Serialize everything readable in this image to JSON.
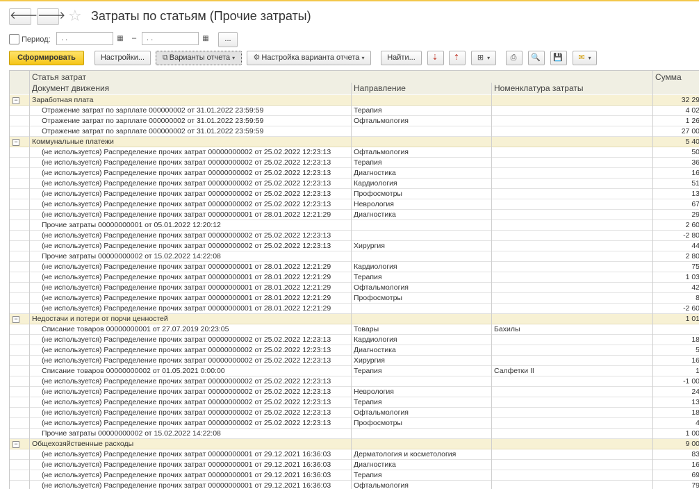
{
  "window": {
    "title": "Затраты по статьям (Прочие затраты)"
  },
  "nav": {
    "back": "🡐",
    "forward": "🡒",
    "star": "☆"
  },
  "period": {
    "label": "Период:",
    "from_value": " .  .",
    "to_value": " .  .",
    "dash": "–",
    "more_label": "..."
  },
  "toolbar": {
    "generate": "Сформировать",
    "settings": "Настройки...",
    "variants": "Варианты отчета",
    "variant_settings": "Настройка варианта отчета",
    "find": "Найти..."
  },
  "icons": {
    "calendar": "▦",
    "variants": "⧉",
    "gear": "⚙",
    "sort_desc": "⇣",
    "sort_asc": "⇡",
    "grouping": "⊞",
    "print": "⎙",
    "preview": "🔍",
    "save": "💾",
    "mail": "✉",
    "caret": "▾",
    "collapse": "−"
  },
  "report": {
    "headers": {
      "col1_line1": "Статья затрат",
      "col1_line2": "Документ движения",
      "col2": "Направление",
      "col3": "Номенклатура затраты",
      "col4": "Сумма"
    },
    "rows": [
      {
        "type": "group",
        "doc": "Заработная плата",
        "dir": "",
        "item": "",
        "sum": "32 29"
      },
      {
        "type": "row",
        "doc": "Отражение затрат по зарплате 000000002 от 31.01.2022 23:59:59",
        "dir": "Терапия",
        "item": "",
        "sum": "4 02"
      },
      {
        "type": "row",
        "doc": "Отражение затрат по зарплате 000000002 от 31.01.2022 23:59:59",
        "dir": "Офтальмология",
        "item": "",
        "sum": "1 26"
      },
      {
        "type": "row",
        "doc": "Отражение затрат по зарплате 000000002 от 31.01.2022 23:59:59",
        "dir": "",
        "item": "",
        "sum": "27 00"
      },
      {
        "type": "group",
        "doc": "Коммунальные платежи",
        "dir": "",
        "item": "",
        "sum": "5 40"
      },
      {
        "type": "row",
        "doc": "(не используется) Распределение прочих затрат 00000000002 от 25.02.2022 12:23:13",
        "dir": "Офтальмология",
        "item": "",
        "sum": "50"
      },
      {
        "type": "row",
        "doc": "(не используется) Распределение прочих затрат 00000000002 от 25.02.2022 12:23:13",
        "dir": "Терапия",
        "item": "",
        "sum": "36"
      },
      {
        "type": "row",
        "doc": "(не используется) Распределение прочих затрат 00000000002 от 25.02.2022 12:23:13",
        "dir": "Диагностика",
        "item": "",
        "sum": "16"
      },
      {
        "type": "row",
        "doc": "(не используется) Распределение прочих затрат 00000000002 от 25.02.2022 12:23:13",
        "dir": "Кардиология",
        "item": "",
        "sum": "51"
      },
      {
        "type": "row",
        "doc": "(не используется) Распределение прочих затрат 00000000002 от 25.02.2022 12:23:13",
        "dir": "Профосмотры",
        "item": "",
        "sum": "13"
      },
      {
        "type": "row",
        "doc": "(не используется) Распределение прочих затрат 00000000002 от 25.02.2022 12:23:13",
        "dir": "Неврология",
        "item": "",
        "sum": "67"
      },
      {
        "type": "row",
        "doc": "(не используется) Распределение прочих затрат 00000000001 от 28.01.2022 12:21:29",
        "dir": "Диагностика",
        "item": "",
        "sum": "29"
      },
      {
        "type": "row",
        "doc": "Прочие затраты 00000000001 от 05.01.2022 12:20:12",
        "dir": "",
        "item": "",
        "sum": "2 60"
      },
      {
        "type": "row",
        "doc": "(не используется) Распределение прочих затрат 00000000002 от 25.02.2022 12:23:13",
        "dir": "",
        "item": "",
        "sum": "-2 80"
      },
      {
        "type": "row",
        "doc": "(не используется) Распределение прочих затрат 00000000002 от 25.02.2022 12:23:13",
        "dir": "Хирургия",
        "item": "",
        "sum": "44"
      },
      {
        "type": "row",
        "doc": "Прочие затраты 00000000002 от 15.02.2022 14:22:08",
        "dir": "",
        "item": "",
        "sum": "2 80"
      },
      {
        "type": "row",
        "doc": "(не используется) Распределение прочих затрат 00000000001 от 28.01.2022 12:21:29",
        "dir": "Кардиология",
        "item": "",
        "sum": "75"
      },
      {
        "type": "row",
        "doc": "(не используется) Распределение прочих затрат 00000000001 от 28.01.2022 12:21:29",
        "dir": "Терапия",
        "item": "",
        "sum": "1 03"
      },
      {
        "type": "row",
        "doc": "(не используется) Распределение прочих затрат 00000000001 от 28.01.2022 12:21:29",
        "dir": "Офтальмология",
        "item": "",
        "sum": "42"
      },
      {
        "type": "row",
        "doc": "(не используется) Распределение прочих затрат 00000000001 от 28.01.2022 12:21:29",
        "dir": "Профосмотры",
        "item": "",
        "sum": "8"
      },
      {
        "type": "row",
        "doc": "(не используется) Распределение прочих затрат 00000000001 от 28.01.2022 12:21:29",
        "dir": "",
        "item": "",
        "sum": "-2 60"
      },
      {
        "type": "group",
        "doc": "Недостачи и потери от порчи ценностей",
        "dir": "",
        "item": "",
        "sum": "1 01"
      },
      {
        "type": "row",
        "doc": "Списание товаров 00000000001 от 27.07.2019 20:23:05",
        "dir": "Товары",
        "item": "Бахилы",
        "sum": ""
      },
      {
        "type": "row",
        "doc": "(не используется) Распределение прочих затрат 00000000002 от 25.02.2022 12:23:13",
        "dir": "Кардиология",
        "item": "",
        "sum": "18"
      },
      {
        "type": "row",
        "doc": "(не используется) Распределение прочих затрат 00000000002 от 25.02.2022 12:23:13",
        "dir": "Диагностика",
        "item": "",
        "sum": "5"
      },
      {
        "type": "row",
        "doc": "(не используется) Распределение прочих затрат 00000000002 от 25.02.2022 12:23:13",
        "dir": "Хирургия",
        "item": "",
        "sum": "16"
      },
      {
        "type": "row",
        "doc": "Списание товаров 00000000002 от 01.05.2021 0:00:00",
        "dir": "Терапия",
        "item": "Салфетки II",
        "sum": "1"
      },
      {
        "type": "row",
        "doc": "(не используется) Распределение прочих затрат 00000000002 от 25.02.2022 12:23:13",
        "dir": "",
        "item": "",
        "sum": "-1 00"
      },
      {
        "type": "row",
        "doc": "(не используется) Распределение прочих затрат 00000000002 от 25.02.2022 12:23:13",
        "dir": "Неврология",
        "item": "",
        "sum": "24"
      },
      {
        "type": "row",
        "doc": "(не используется) Распределение прочих затрат 00000000002 от 25.02.2022 12:23:13",
        "dir": "Терапия",
        "item": "",
        "sum": "13"
      },
      {
        "type": "row",
        "doc": "(не используется) Распределение прочих затрат 00000000002 от 25.02.2022 12:23:13",
        "dir": "Офтальмология",
        "item": "",
        "sum": "18"
      },
      {
        "type": "row",
        "doc": "(не используется) Распределение прочих затрат 00000000002 от 25.02.2022 12:23:13",
        "dir": "Профосмотры",
        "item": "",
        "sum": "4"
      },
      {
        "type": "row",
        "doc": "Прочие затраты 00000000002 от 15.02.2022 14:22:08",
        "dir": "",
        "item": "",
        "sum": "1 00"
      },
      {
        "type": "group",
        "doc": "Общехозяйственные расходы",
        "dir": "",
        "item": "",
        "sum": "9 00"
      },
      {
        "type": "row",
        "doc": "(не используется) Распределение прочих затрат 00000000001 от 29.12.2021 16:36:03",
        "dir": "Дерматология и косметология",
        "item": "",
        "sum": "83"
      },
      {
        "type": "row",
        "doc": "(не используется) Распределение прочих затрат 00000000001 от 29.12.2021 16:36:03",
        "dir": "Диагностика",
        "item": "",
        "sum": "16"
      },
      {
        "type": "row",
        "doc": "(не используется) Распределение прочих затрат 00000000001 от 29.12.2021 16:36:03",
        "dir": "Терапия",
        "item": "",
        "sum": "69"
      },
      {
        "type": "row",
        "doc": "(не используется) Распределение прочих затрат 00000000001 от 29.12.2021 16:36:03",
        "dir": "Офтальмология",
        "item": "",
        "sum": "79"
      }
    ]
  }
}
